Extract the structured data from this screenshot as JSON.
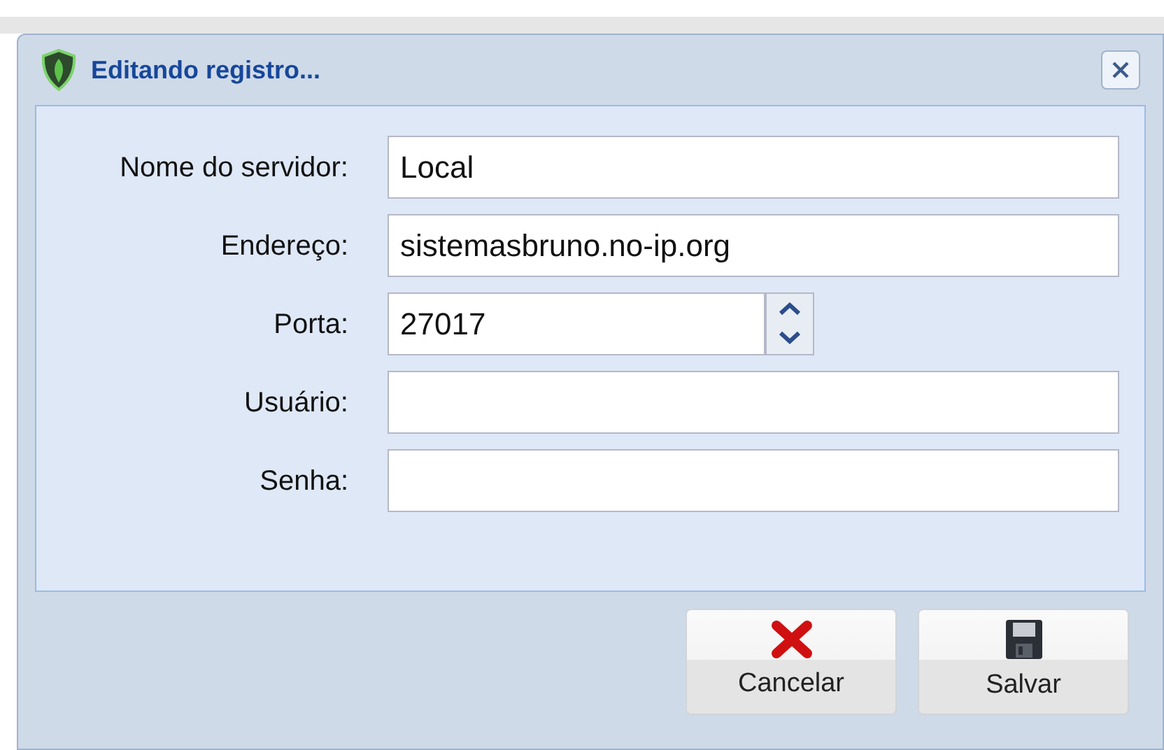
{
  "window": {
    "title": "Editando registro..."
  },
  "fields": [
    {
      "label": "Nome do servidor:",
      "value": "Local",
      "kind": "text"
    },
    {
      "label": "Endereço:",
      "value": "sistemasbruno.no-ip.org",
      "kind": "text"
    },
    {
      "label": "Porta:",
      "value": "27017",
      "kind": "number"
    },
    {
      "label": "Usuário:",
      "kind": "text"
    },
    {
      "label": "Senha:",
      "kind": "password"
    }
  ],
  "buttons": [
    {
      "label": "Cancelar",
      "kind": "cancel"
    },
    {
      "label": "Salvar",
      "kind": "save"
    }
  ]
}
